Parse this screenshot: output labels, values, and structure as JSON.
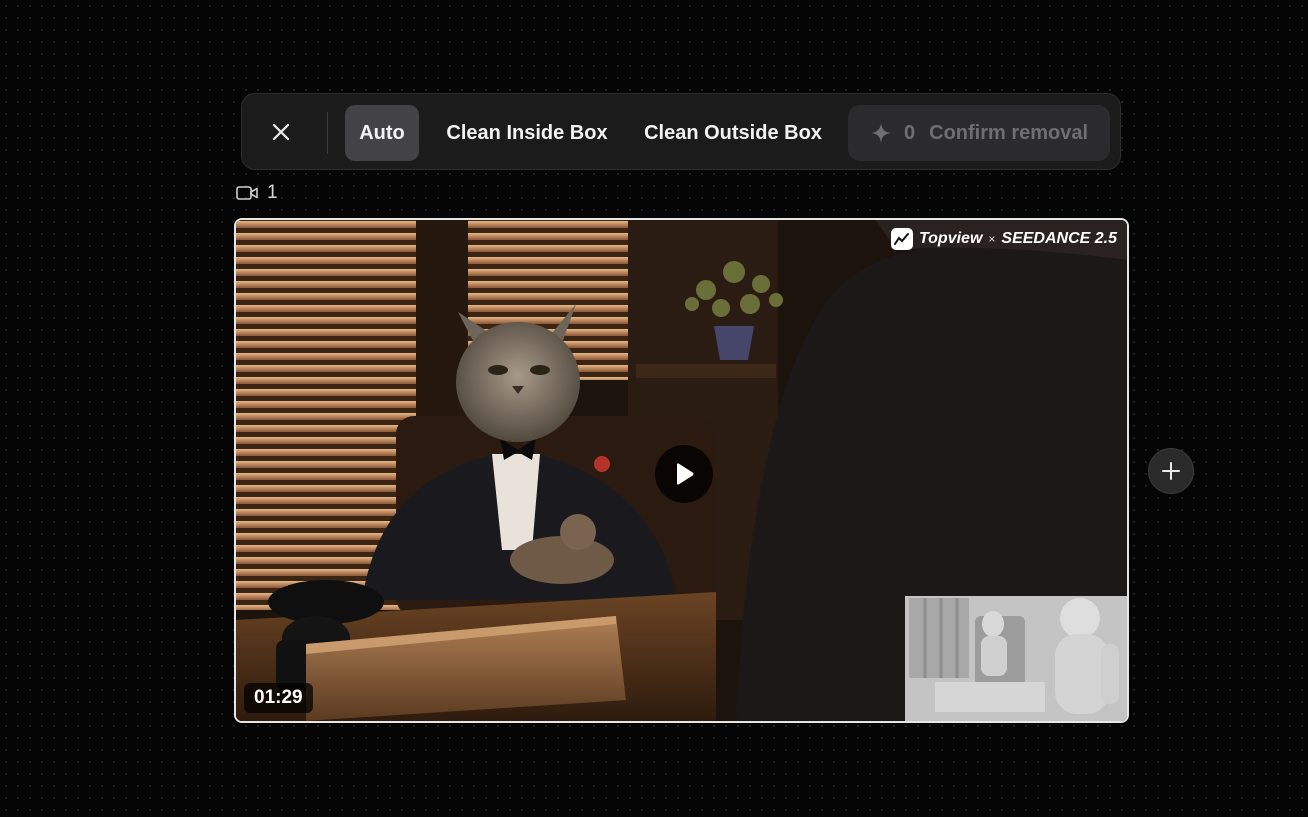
{
  "toolbar": {
    "close_icon": "close-icon",
    "auto_label": "Auto",
    "clean_inside_label": "Clean Inside Box",
    "clean_outside_label": "Clean Outside Box",
    "confirm": {
      "icon": "sparkle-icon",
      "count": "0",
      "label": "Confirm removal"
    }
  },
  "video_label": {
    "icon": "video-camera-icon",
    "count": "1"
  },
  "video": {
    "watermark": {
      "brand": "Topview",
      "separator": "×",
      "partner": "SEEDANCE 2.5"
    },
    "duration": "01:29",
    "play_icon": "play-icon",
    "thumbnail_icon": "render-preview-thumbnail"
  },
  "add_button": {
    "icon": "plus-icon"
  },
  "colors": {
    "background": "#050505",
    "toolbar_bg": "#1b1b1c",
    "active_tab": "#434345",
    "confirm_disabled_text": "#6f6f72"
  }
}
